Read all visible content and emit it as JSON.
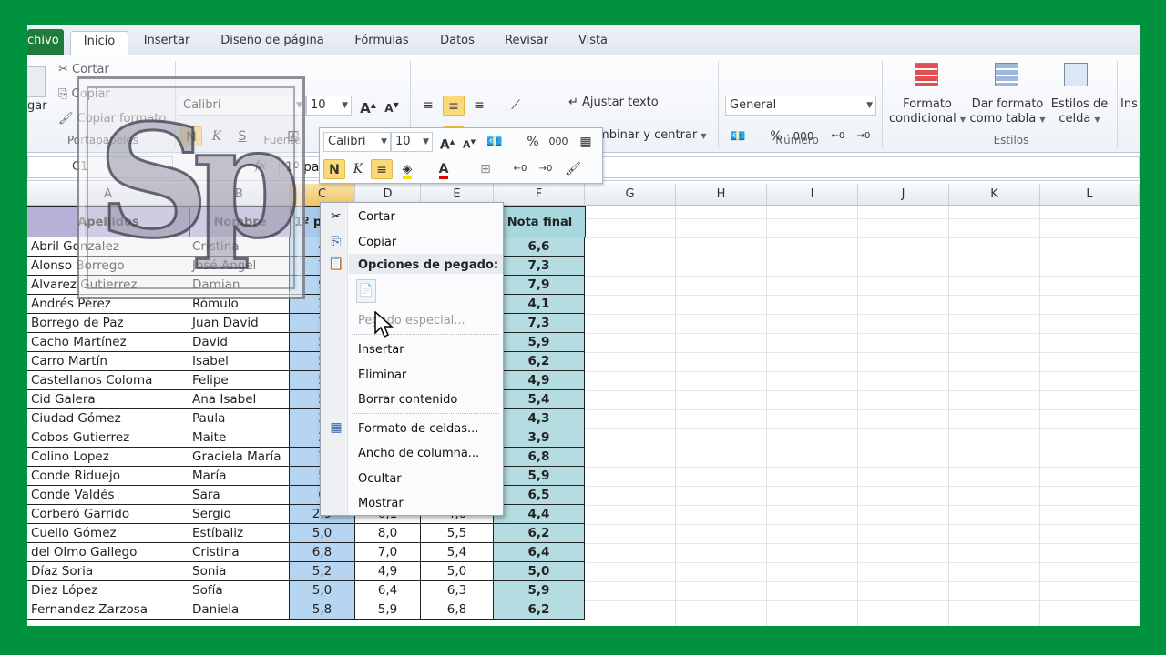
{
  "tabs": [
    {
      "label": "chivo"
    },
    {
      "label": "Inicio"
    },
    {
      "label": "Insertar"
    },
    {
      "label": "Diseño de página"
    },
    {
      "label": "Fórmulas"
    },
    {
      "label": "Datos"
    },
    {
      "label": "Revisar"
    },
    {
      "label": "Vista"
    }
  ],
  "ribbon": {
    "clipboard": {
      "cut": "Cortar",
      "copy": "Copiar",
      "format_painter": "Copiar formato",
      "paste_partial": "gar",
      "group": "Portapapeles"
    },
    "font": {
      "name": "Calibri",
      "size": "10",
      "group": "Fuente",
      "bold": "N",
      "italic": "K",
      "underline": "S"
    },
    "alignment": {
      "wrap": "Ajustar texto",
      "merge": "Combinar y centrar"
    },
    "number": {
      "format": "General",
      "percent": "%",
      "thousands": "000",
      "group": "Número"
    },
    "styles": {
      "conditional_1": "Formato",
      "conditional_2": "condicional",
      "table_1": "Dar formato",
      "table_2": "como tabla",
      "cell_1": "Estilos de",
      "cell_2": "celda",
      "group": "Estilos"
    },
    "insert_partial": "Ins"
  },
  "formula_bar": {
    "name_box": "C1",
    "fx": "fx",
    "content": "1º pa"
  },
  "mini_toolbar": {
    "font": "Calibri",
    "size": "10",
    "bold": "N",
    "italic": "K",
    "percent": "%",
    "thousands": "000"
  },
  "columns": [
    "C",
    "D",
    "E",
    "F",
    "G",
    "H",
    "I",
    "J",
    "K",
    "L"
  ],
  "col_a_partial": "A",
  "col_b_partial": "B",
  "table": {
    "headers": {
      "apellidos": "Apellidos",
      "nombre": "Nombre",
      "c": "1º p",
      "f": "Nota final"
    },
    "rows": [
      {
        "ap": "Abril Gonzalez",
        "no": "Cristina",
        "c": "4",
        "d": "",
        "e": "",
        "f": "6,6"
      },
      {
        "ap": "Alonso Borrego",
        "no": "José Angel",
        "c": "7",
        "d": "",
        "e": "",
        "f": "7,3"
      },
      {
        "ap": "Alvarez Gutierrez",
        "no": "Damian",
        "c": "9",
        "d": "",
        "e": "",
        "f": "7,9"
      },
      {
        "ap": "Andrés Pérez",
        "no": "Rómulo",
        "c": "2",
        "d": "",
        "e": "",
        "f": "4,1"
      },
      {
        "ap": "Borrego de Paz",
        "no": "Juan David",
        "c": "7",
        "d": "",
        "e": "",
        "f": "7,3"
      },
      {
        "ap": "Cacho Martínez",
        "no": "David",
        "c": "5",
        "d": "",
        "e": "",
        "f": "5,9"
      },
      {
        "ap": "Carro Martín",
        "no": "Isabel",
        "c": "5",
        "d": "",
        "e": "",
        "f": "6,2"
      },
      {
        "ap": "Castellanos Coloma",
        "no": "Felipe",
        "c": "5",
        "d": "",
        "e": "",
        "f": "4,9"
      },
      {
        "ap": "Cid Galera",
        "no": "Ana Isabel",
        "c": "5",
        "d": "",
        "e": "",
        "f": "5,4"
      },
      {
        "ap": "Ciudad Gómez",
        "no": "Paula",
        "c": "3",
        "d": "",
        "e": "",
        "f": "4,3"
      },
      {
        "ap": "Cobos Gutierrez",
        "no": "Maite",
        "c": "2",
        "d": "",
        "e": "",
        "f": "3,9"
      },
      {
        "ap": "Colino Lopez",
        "no": "Graciela María",
        "c": "7",
        "d": "",
        "e": "",
        "f": "6,8"
      },
      {
        "ap": "Conde Riduejo",
        "no": "María",
        "c": "5",
        "d": "",
        "e": "",
        "f": "5,9"
      },
      {
        "ap": "Conde Valdés",
        "no": "Sara",
        "c": "6",
        "d": "",
        "e": "",
        "f": "6,5"
      },
      {
        "ap": "Corberó Garrido",
        "no": "Sergio",
        "c": "2,9",
        "d": "6,1",
        "e": "4,0",
        "f": "4,4"
      },
      {
        "ap": "Cuello Gómez",
        "no": "Estíbaliz",
        "c": "5,0",
        "d": "8,0",
        "e": "5,5",
        "f": "6,2"
      },
      {
        "ap": "del Olmo Gallego",
        "no": "Cristina",
        "c": "6,8",
        "d": "7,0",
        "e": "5,4",
        "f": "6,4"
      },
      {
        "ap": "Díaz Soria",
        "no": "Sonia",
        "c": "5,2",
        "d": "4,9",
        "e": "5,0",
        "f": "5,0"
      },
      {
        "ap": "Diez López",
        "no": "Sofía",
        "c": "5,0",
        "d": "6,4",
        "e": "6,3",
        "f": "5,9"
      },
      {
        "ap": "Fernandez Zarzosa",
        "no": "Daniela",
        "c": "5,8",
        "d": "5,9",
        "e": "6,8",
        "f": "6,2"
      }
    ]
  },
  "context_menu": {
    "cut": "Cortar",
    "copy": "Copiar",
    "paste_options": "Opciones de pegado:",
    "paste_special": "Pegado especial...",
    "insert": "Insertar",
    "delete": "Eliminar",
    "clear": "Borrar contenido",
    "format_cells": "Formato de celdas...",
    "column_width": "Ancho de columna...",
    "hide": "Ocultar",
    "show": "Mostrar"
  },
  "logo": {
    "text": "Sp"
  }
}
